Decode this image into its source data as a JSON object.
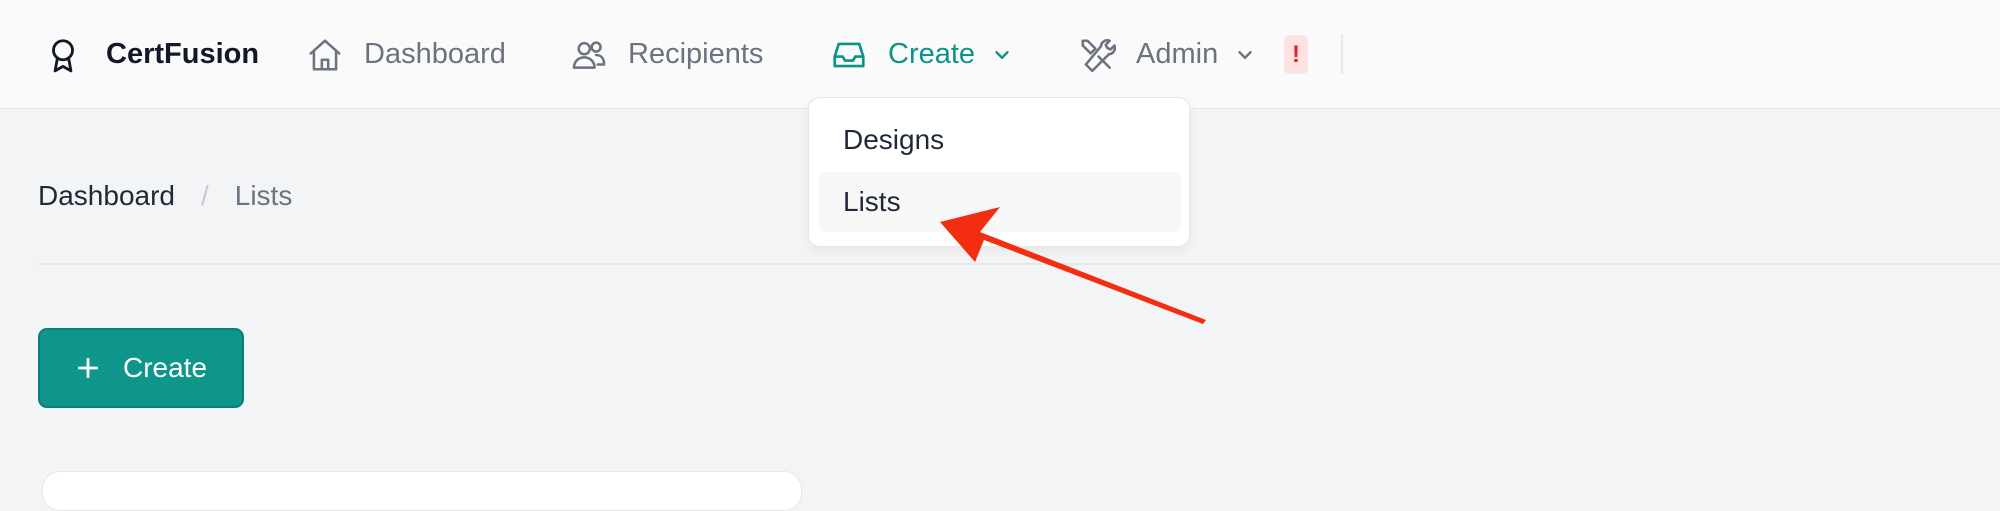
{
  "nav": {
    "brand": "CertFusion",
    "items": {
      "dashboard": "Dashboard",
      "recipients": "Recipients",
      "create": "Create",
      "admin": "Admin"
    },
    "alert_badge": "!",
    "accent_color": "#0d9488"
  },
  "dropdown": {
    "items": [
      "Designs",
      "Lists"
    ],
    "highlighted": "Lists"
  },
  "breadcrumb": {
    "home": "Dashboard",
    "separator": "/",
    "current": "Lists"
  },
  "main": {
    "create_button": "Create"
  },
  "icons": {
    "brand": "award-ribbon-icon",
    "dashboard": "home-icon",
    "recipients": "users-icon",
    "create": "inbox-tray-icon",
    "admin": "tools-icon",
    "create_button": "plus-icon",
    "annotation": "red-arrow-icon"
  },
  "colors": {
    "primary_button": "#0f968a",
    "alert_badge_bg": "#fde2e2",
    "annotation_arrow": "#f32d0f"
  }
}
